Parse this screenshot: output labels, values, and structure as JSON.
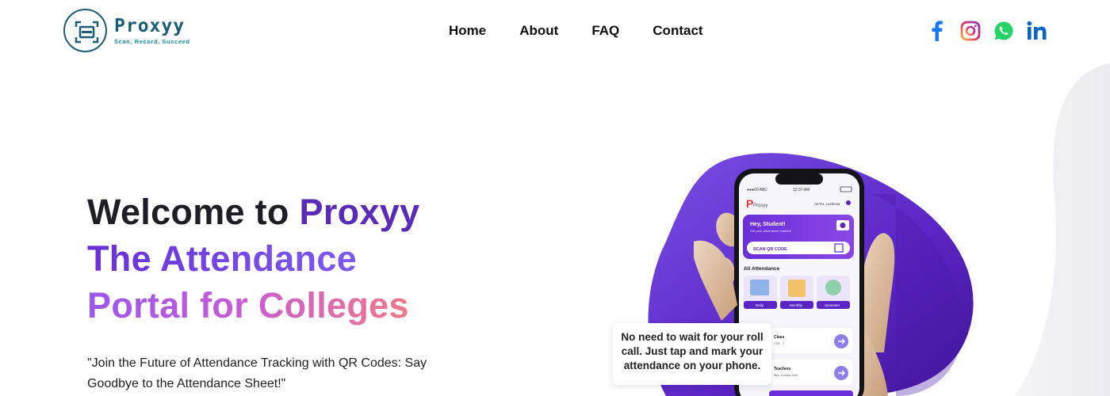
{
  "brand": {
    "name": "Proxyy",
    "tagline": "Scan, Record, Succeed"
  },
  "nav": [
    {
      "label": "Home"
    },
    {
      "label": "About"
    },
    {
      "label": "FAQ"
    },
    {
      "label": "Contact"
    }
  ],
  "social": [
    {
      "icon": "facebook-icon",
      "color": "#1877f2"
    },
    {
      "icon": "instagram-icon",
      "color": "#e1306c"
    },
    {
      "icon": "whatsapp-icon",
      "color": "#25d366"
    },
    {
      "icon": "linkedin-icon",
      "color": "#0a66c2"
    }
  ],
  "hero": {
    "title_prefix": "Welcome to ",
    "title_brand": "Proxyy",
    "line2": "The Attendance",
    "line3": "Portal for Colleges",
    "quote": "\"Join the Future of Attendance Tracking with QR Codes: Say Goodbye to the Attendance Sheet!\""
  },
  "phone": {
    "status_time": "12:37 AM",
    "carrier": "●●●00 ABC",
    "location": "AKTU, Lucknow",
    "app_name": "Proxyy",
    "greeting": "Hey, Student!",
    "sub_greeting": "Get your attendance marked!",
    "scan_label": "SCAN QR CODE",
    "section_title": "All Attendance",
    "tiles": [
      "Daily",
      "Monthly",
      "Semester"
    ],
    "cards": [
      {
        "title": "Class",
        "sub": "CSE - I"
      },
      {
        "title": "Teachers",
        "sub": "Mrs. Kanika Soni"
      }
    ]
  },
  "callout": "No need to wait for your roll call. Just tap and mark your attendance on your phone.",
  "colors": {
    "brand_teal": "#1b5e73",
    "purple": "#5b2bb8",
    "blob": "#6b35d6"
  }
}
